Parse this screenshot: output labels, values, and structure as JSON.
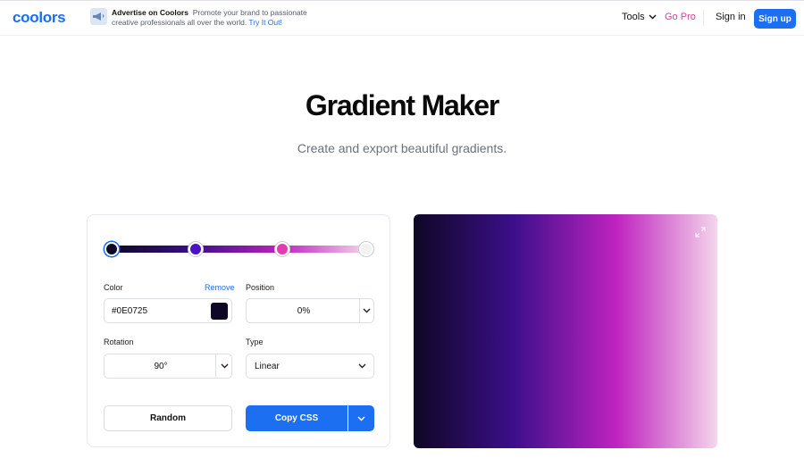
{
  "header": {
    "logo": "coolors",
    "ad": {
      "title": "Advertise on Coolors",
      "body": "Promote your brand to passionate creative professionals all over the world.",
      "link": "Try It Out!"
    },
    "nav": {
      "tools": "Tools",
      "go_pro": "Go Pro",
      "sign_in": "Sign in",
      "sign_up": "Sign up"
    }
  },
  "hero": {
    "title": "Gradient Maker",
    "subtitle": "Create and export beautiful gradients."
  },
  "editor": {
    "stops": [
      {
        "color": "#0E0725",
        "position": 0,
        "selected": true
      },
      {
        "color": "#4A12C4",
        "position": 33
      },
      {
        "color": "#E63AAE",
        "position": 67
      },
      {
        "color": "#F2F2F2",
        "position": 100
      }
    ],
    "color_label": "Color",
    "remove_label": "Remove",
    "color_value": "#0E0725",
    "position_label": "Position",
    "position_value": "0%",
    "rotation_label": "Rotation",
    "rotation_value": "90°",
    "type_label": "Type",
    "type_value": "Linear",
    "random_label": "Random",
    "copy_label": "Copy CSS"
  },
  "colors": {
    "accent": "#1B6FF0",
    "go_pro": "#E63A9A"
  },
  "icons": [
    "megaphone-icon",
    "chevron-down-icon",
    "expand-icon"
  ]
}
